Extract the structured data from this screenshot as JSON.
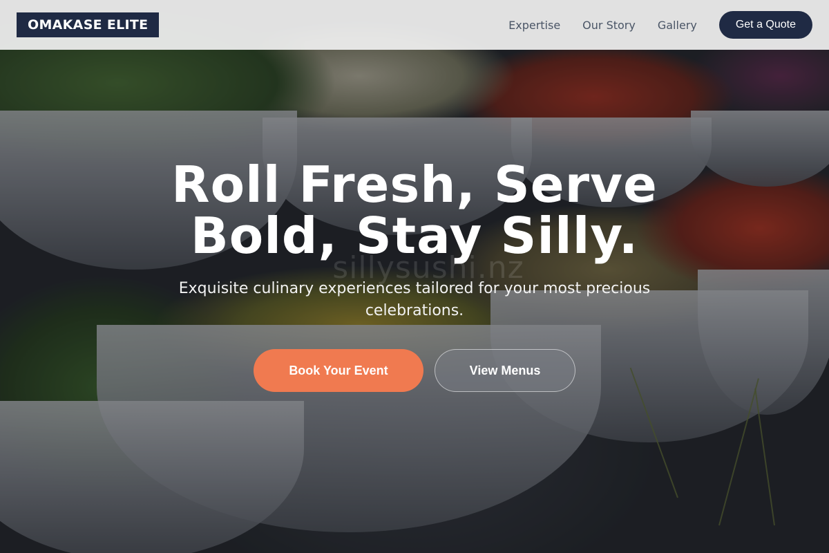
{
  "brand": {
    "name": "OMAKASE ELITE"
  },
  "nav": {
    "links": [
      "Expertise",
      "Our Story",
      "Gallery"
    ],
    "cta": "Get a Quote"
  },
  "hero": {
    "headline": "Roll Fresh, Serve Bold, Stay Silly.",
    "subtitle": "Exquisite culinary experiences tailored for your most precious celebrations.",
    "watermark": "sillysushi.nz",
    "primary_button": "Book Your Event",
    "secondary_button": "View Menus"
  },
  "colors": {
    "navy": "#1f2a44",
    "accent": "#f07a50",
    "nav_bg": "#f0f0f0"
  }
}
